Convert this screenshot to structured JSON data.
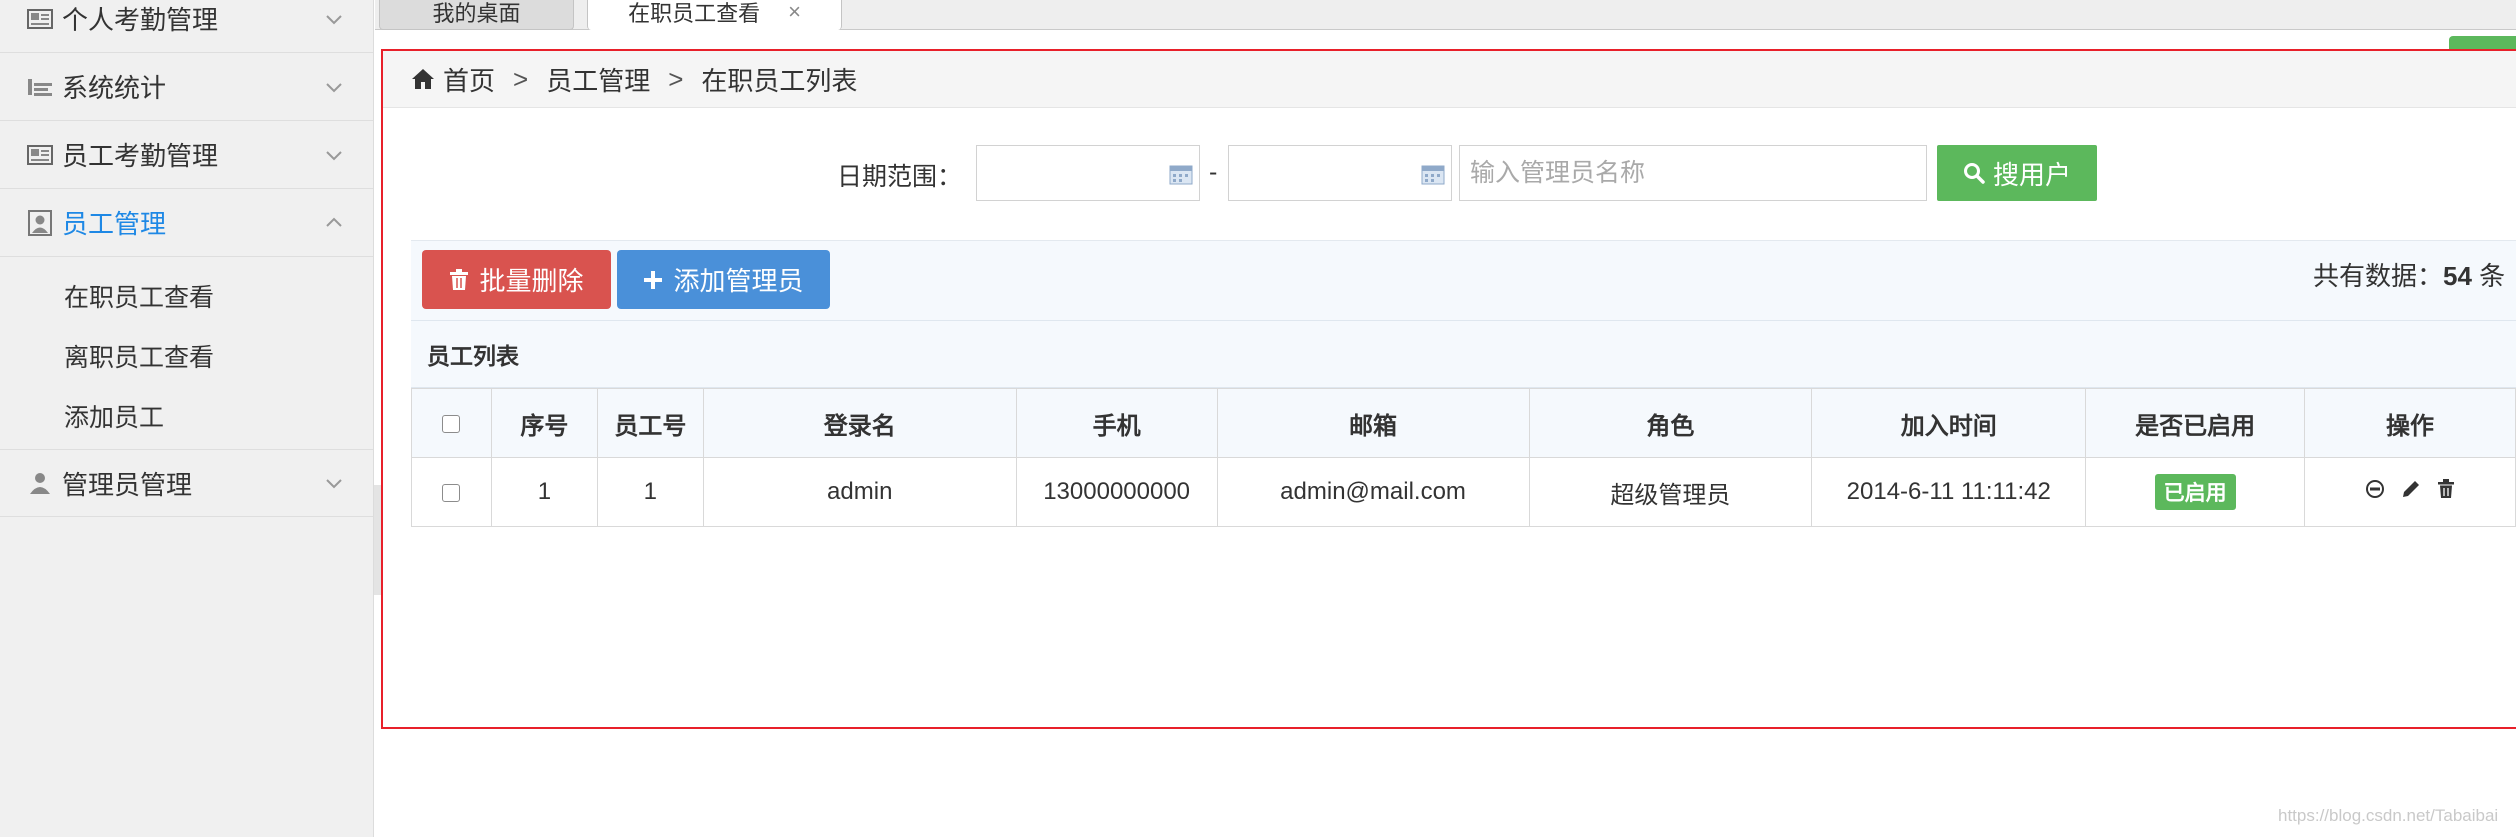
{
  "sidebar": {
    "items": [
      {
        "label": "个人考勤管理",
        "icon": "image-card-icon"
      },
      {
        "label": "系统统计",
        "icon": "bar-chart-icon"
      },
      {
        "label": "员工考勤管理",
        "icon": "image-card-icon"
      },
      {
        "label": "员工管理",
        "icon": "user-card-icon",
        "expanded": true
      },
      {
        "label": "管理员管理",
        "icon": "user-icon"
      }
    ],
    "subitems": [
      "在职员工查看",
      "离职员工查看",
      "添加员工"
    ]
  },
  "tabs": [
    {
      "label": "我的桌面"
    },
    {
      "label": "在职员工查看",
      "close": "×"
    }
  ],
  "breadcrumb": {
    "home": "首页",
    "sep": ">",
    "level1": "员工管理",
    "level2": "在职员工列表"
  },
  "search": {
    "label": "日期范围：",
    "start_value": "",
    "end_value": "",
    "dash": "-",
    "name_placeholder": "输入管理员名称",
    "button_label": "搜用户"
  },
  "toolbar": {
    "delete_label": "批量删除",
    "add_label": "添加管理员",
    "count_prefix": "共有数据：",
    "count_value": "54",
    "count_suffix": "条"
  },
  "table": {
    "caption": "员工列表",
    "columns": [
      "序号",
      "员工号",
      "登录名",
      "手机",
      "邮箱",
      "角色",
      "加入时间",
      "是否已启用",
      "操作"
    ],
    "rows": [
      {
        "index": "1",
        "emp_no": "1",
        "login": "admin",
        "phone": "13000000000",
        "email": "admin@mail.com",
        "role": "超级管理员",
        "joined": "2014-6-11 11:11:42",
        "status": "已启用"
      }
    ]
  },
  "colors": {
    "accent": "#1e88e5",
    "success": "#5cb85c",
    "danger": "#d9534f",
    "primary": "#4a90d9",
    "frame_border": "#e8202a"
  },
  "watermark": "https://blog.csdn.net/Tabaibai"
}
